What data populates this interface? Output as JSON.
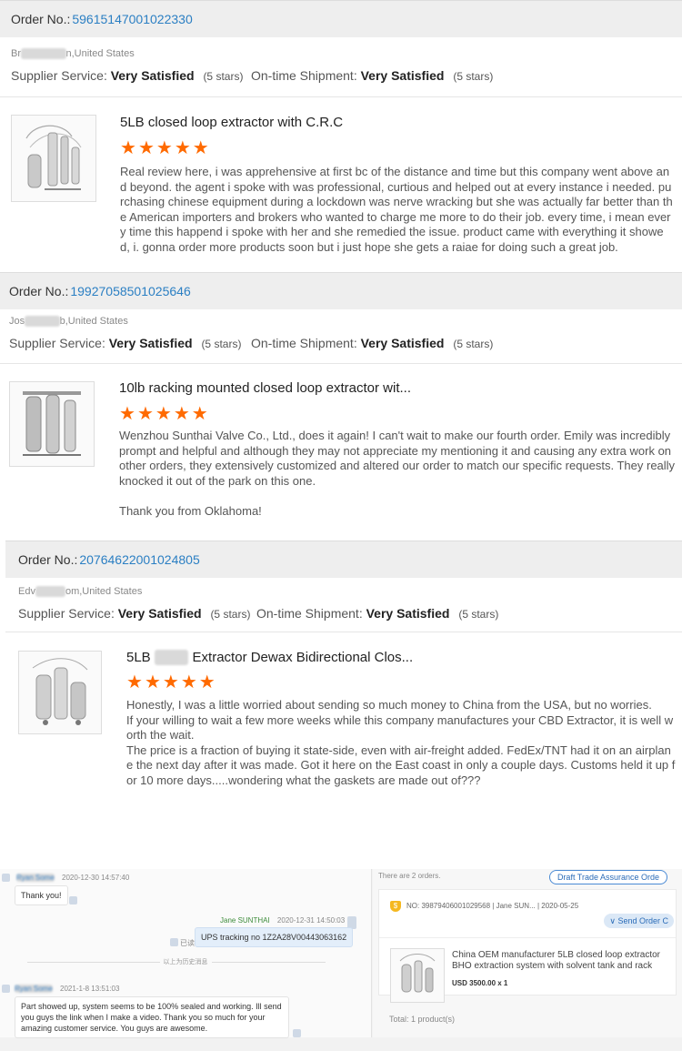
{
  "reviews": [
    {
      "order_label": "Order No.:",
      "order_number": "59615147001022330",
      "buyer_left": "Br",
      "buyer_right": "n,United States",
      "supplier_label": "Supplier Service:",
      "supplier_value": "Very Satisfied",
      "supplier_stars": "(5 stars)",
      "shipment_label": "On-time Shipment:",
      "shipment_value": "Very Satisfied",
      "shipment_stars": "(5 stars)",
      "product_title": "5LB closed loop extractor with C.R.C",
      "rating": 5,
      "paragraphs": [
        "Real review here, i was apprehensive at first bc of the distance and time but this company went above and beyond. the agent i spoke with was professional, curtious and helped out at every instance i needed. purchasing chinese equipment during a lockdown was nerve wracking but she was actually far better than the American importers and brokers who wanted to charge me more to do their job. every time, i mean every time this happend i spoke with her and she remedied the issue. product came with everything it showed, i. gonna order more products soon but i just hope she gets a raiae for doing such a great job."
      ]
    },
    {
      "order_label": "Order No.:",
      "order_number": "19927058501025646",
      "buyer_left": "Jos",
      "buyer_right": "b,United States",
      "supplier_label": "Supplier Service:",
      "supplier_value": "Very Satisfied",
      "supplier_stars": "(5 stars)",
      "shipment_label": "On-time Shipment:",
      "shipment_value": "Very Satisfied",
      "shipment_stars": "(5 stars)",
      "product_title": "10lb racking mounted closed loop extractor wit...",
      "rating": 5,
      "paragraphs": [
        "Wenzhou Sunthai Valve Co., Ltd., does it again!  I can't wait to make our fourth order.  Emily was incredibly prompt and helpful and although they may not appreciate my mentioning it and causing any extra work on other orders, they extensively customized and altered our order to match our specific requests.  They really knocked it out of the park on this one.",
        "Thank you from Oklahoma!"
      ]
    },
    {
      "order_label": "Order No.:",
      "order_number": "20764622001024805",
      "buyer_left": "Edv",
      "buyer_right": "om,United States",
      "supplier_label": "Supplier Service:",
      "supplier_value": "Very Satisfied",
      "supplier_stars": "(5 stars)",
      "shipment_label": "On-time Shipment:",
      "shipment_value": "Very Satisfied",
      "shipment_stars": "(5 stars)",
      "product_title": "5LB",
      "product_title_rest": "Extractor Dewax Bidirectional Clos...",
      "rating": 5,
      "paragraphs": [
        "Honestly, I was a little worried about sending so much money to China from the USA, but no worries.",
        "If your willing to wait a few more weeks while this company manufactures your CBD Extractor, it is well worth the wait.",
        "The price is a fraction of buying it state-side, even with air-freight added.  FedEx/TNT had it on an airplane the next day after it was made.  Got it here on the East coast in only a couple days.  Customs held it up for 10 more days.....wondering what the gaskets are made out of???"
      ]
    }
  ],
  "chat": {
    "msg1_time": "2020-12-30 14:57:40",
    "msg1_text": "Thank you!",
    "msg2_name": "Jane SUNTHAI",
    "msg2_time": "2020-12-31 14:50:03",
    "msg2_text": "UPS  tracking no 1Z2A28V00443063162",
    "msg2_read": "已读",
    "history_label": "以上为历史消息",
    "msg3_time": "2021-1-8 13:51:03",
    "msg3_text": "Part showed up, system seems to be 100% sealed and working. Ill send you guys the link when I make a video. Thank you so much for your amazing customer service. You guys are awesome.",
    "orders_count": "There are 2 orders.",
    "draft_button": "Draft Trade Assurance Orde",
    "order_no_line": "NO: 39879406001029568 | Jane SUN...  | 2020-05-25",
    "send_button": "Send Order C",
    "product_line1": "China OEM manufacturer 5LB closed loop extractor",
    "product_line2": "BHO extraction system with solvent tank and rack",
    "price": "USD 3500.00 x 1",
    "total": "Total:  1 product(s)"
  }
}
